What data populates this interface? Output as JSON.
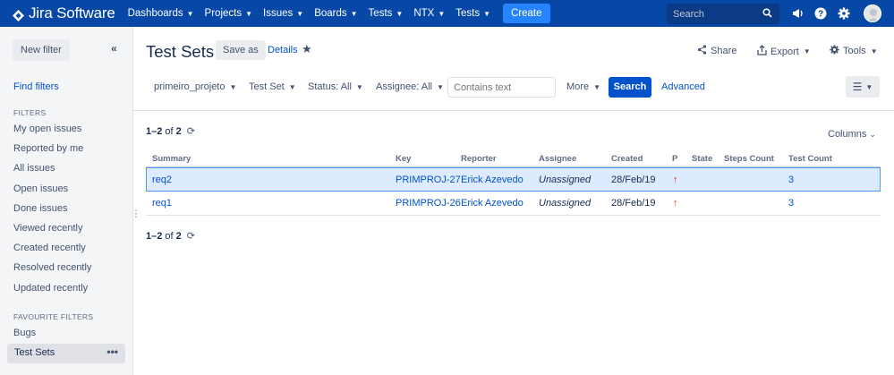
{
  "topnav": {
    "logo_text": "Jira Software",
    "items": [
      {
        "label": "Dashboards"
      },
      {
        "label": "Projects"
      },
      {
        "label": "Issues"
      },
      {
        "label": "Boards"
      },
      {
        "label": "Tests"
      },
      {
        "label": "NTX"
      },
      {
        "label": "Tests"
      }
    ],
    "create_label": "Create",
    "search_placeholder": "Search",
    "colors": {
      "bar": "#0747a6",
      "create": "#2684ff"
    }
  },
  "sidebar": {
    "new_filter_label": "New filter",
    "collapse_glyph": "«",
    "find_filters_label": "Find filters",
    "filters_heading": "FILTERS",
    "filters": [
      {
        "label": "My open issues"
      },
      {
        "label": "Reported by me"
      },
      {
        "label": "All issues"
      },
      {
        "label": "Open issues"
      },
      {
        "label": "Done issues"
      },
      {
        "label": "Viewed recently"
      },
      {
        "label": "Created recently"
      },
      {
        "label": "Resolved recently"
      },
      {
        "label": "Updated recently"
      }
    ],
    "favourites_heading": "FAVOURITE FILTERS",
    "favourites": [
      {
        "label": "Bugs"
      },
      {
        "label": "Test Sets",
        "active": true
      }
    ],
    "more_glyph": "•••"
  },
  "main": {
    "title": "Test Sets",
    "save_as_label": "Save as",
    "details_label": "Details",
    "share_label": "Share",
    "export_label": "Export",
    "tools_label": "Tools",
    "filters": {
      "project": "primeiro_projeto",
      "type": "Test Set",
      "status": "Status: All",
      "assignee": "Assignee: All",
      "text_placeholder": "Contains text",
      "more": "More",
      "search_label": "Search",
      "advanced_label": "Advanced"
    },
    "pager_top": {
      "range": "1–2",
      "of": "of",
      "total": "2"
    },
    "pager_bottom": {
      "range": "1–2",
      "of": "of",
      "total": "2"
    },
    "columns_label": "Columns",
    "table": {
      "headers": [
        "Summary",
        "Key",
        "Reporter",
        "Assignee",
        "Created",
        "P",
        "State",
        "Steps Count",
        "Test Count"
      ],
      "rows": [
        {
          "summary": "req2",
          "key": "PRIMPROJ-27",
          "reporter": "Erick Azevedo",
          "assignee": "Unassigned",
          "created": "28/Feb/19",
          "priority": "↑",
          "state": "",
          "steps_count": "",
          "test_count": "3",
          "selected": true
        },
        {
          "summary": "req1",
          "key": "PRIMPROJ-26",
          "reporter": "Erick Azevedo",
          "assignee": "Unassigned",
          "created": "28/Feb/19",
          "priority": "↑",
          "state": "",
          "steps_count": "",
          "test_count": "3",
          "selected": false
        }
      ]
    }
  }
}
